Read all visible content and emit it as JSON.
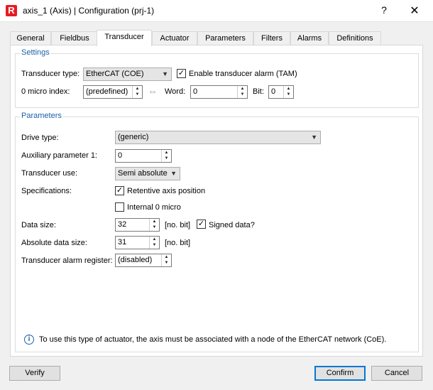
{
  "window": {
    "app_icon_letter": "R",
    "title": "axis_1 (Axis) | Configuration (prj-1)",
    "help": "?",
    "close": "✕"
  },
  "tabs": [
    {
      "label": "General"
    },
    {
      "label": "Fieldbus"
    },
    {
      "label": "Transducer",
      "active": true
    },
    {
      "label": "Actuator"
    },
    {
      "label": "Parameters"
    },
    {
      "label": "Filters"
    },
    {
      "label": "Alarms"
    },
    {
      "label": "Definitions"
    }
  ],
  "settings": {
    "title": "Settings",
    "transducer_type_label": "Transducer type:",
    "transducer_type_value": "EtherCAT (COE)",
    "enable_alarm_label": "Enable transducer alarm (TAM)",
    "enable_alarm_checked": true,
    "zero_index_label": "0 micro index:",
    "zero_index_value": "(predefined)",
    "word_label": "Word:",
    "word_value": "0",
    "bit_label": "Bit:",
    "bit_value": "0"
  },
  "parameters": {
    "title": "Parameters",
    "drive_type_label": "Drive type:",
    "drive_type_value": "(generic)",
    "aux_param_label": "Auxiliary parameter 1:",
    "aux_param_value": "0",
    "transducer_use_label": "Transducer use:",
    "transducer_use_value": "Semi absolute",
    "specifications_label": "Specifications:",
    "retentive_label": "Retentive axis position",
    "retentive_checked": true,
    "internal_zero_label": "Internal 0 micro",
    "internal_zero_checked": false,
    "data_size_label": "Data size:",
    "data_size_value": "32",
    "data_size_unit": "[no. bit]",
    "signed_label": "Signed data?",
    "signed_checked": true,
    "abs_data_size_label": "Absolute data size:",
    "abs_data_size_value": "31",
    "abs_data_size_unit": "[no. bit]",
    "alarm_register_label": "Transducer alarm register:",
    "alarm_register_value": "(disabled)"
  },
  "info": {
    "icon": "i",
    "text": "To use this type of actuator, the axis must be associated with a node of the EtherCAT network (CoE)."
  },
  "footer": {
    "verify": "Verify",
    "confirm": "Confirm",
    "cancel": "Cancel"
  },
  "glyphs": {
    "check": "✓",
    "arrow_down": "▼",
    "arrow_up_small": "▲",
    "arrow_down_small": "▼",
    "link": "⇔"
  }
}
